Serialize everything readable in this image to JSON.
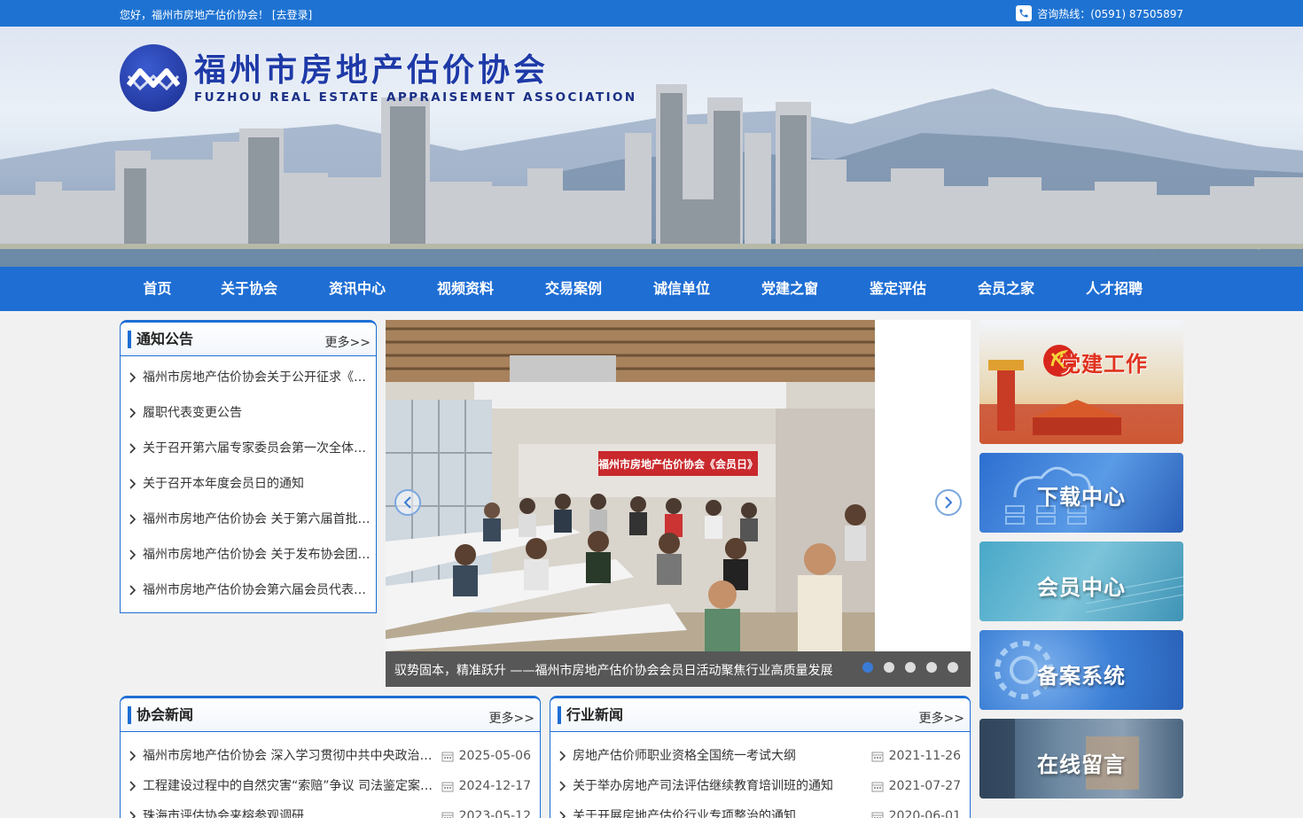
{
  "topbar": {
    "greeting": "您好，福州市房地产估价协会！",
    "login": "[去登录]",
    "hotline_label": "咨询热线：(0591) 87505897"
  },
  "header": {
    "org_name_cn": "福州市房地产估价协会",
    "org_name_en": "FUZHOU REAL ESTATE APPRAISEMENT ASSOCIATION"
  },
  "nav": {
    "items": [
      "首页",
      "关于协会",
      "资讯中心",
      "视频资料",
      "交易案例",
      "诚信单位",
      "党建之窗",
      "鉴定评估",
      "会员之家",
      "人才招聘"
    ]
  },
  "notices": {
    "title": "通知公告",
    "more": "更多>>",
    "items": [
      "福州市房地产估价协会关于公开征求《福州市房地产估价协会章程》修改意见的通知",
      "履职代表变更公告",
      "关于召开第六届专家委员会第一次全体会议的通知",
      "关于召开本年度会员日的通知",
      "福州市房地产估价协会 关于第六届首批专家委员会委员名单的公示",
      "福州市房地产估价协会 关于发布协会团体标准的通知",
      "福州市房地产估价协会第六届会员代表大会公告"
    ]
  },
  "slider": {
    "banner_text": "福州市房地产估价协会《会员日》",
    "caption": "驭势固本，精准跃升 ——福州市房地产估价协会会员日活动聚焦行业高质量发展",
    "dot_count": 5,
    "active_dot": 0
  },
  "assoc_news": {
    "title": "协会新闻",
    "more": "更多>>",
    "items": [
      {
        "title": "福州市房地产估价协会 深入学习贯彻中共中央政治局会议精神",
        "date": "2025-05-06"
      },
      {
        "title": "工程建设过程中的自然灾害“索赔”争议 司法鉴定案例分析",
        "date": "2024-12-17"
      },
      {
        "title": "珠海市评估协会来榕参观调研",
        "date": "2023-05-12"
      }
    ]
  },
  "industry_news": {
    "title": "行业新闻",
    "more": "更多>>",
    "items": [
      {
        "title": "房地产估价师职业资格全国统一考试大纲",
        "date": "2021-11-26"
      },
      {
        "title": "关于举办房地产司法评估继续教育培训班的通知",
        "date": "2021-07-27"
      },
      {
        "title": "关于开展房地产估价行业专项整治的通知",
        "date": "2020-06-01"
      }
    ]
  },
  "tiles": {
    "party": "党建工作",
    "download": "下载中心",
    "member": "会员中心",
    "filing": "备案系统",
    "message": "在线留言"
  },
  "colors": {
    "primary": "#1e6ed4",
    "topbar": "#1e73d2"
  }
}
